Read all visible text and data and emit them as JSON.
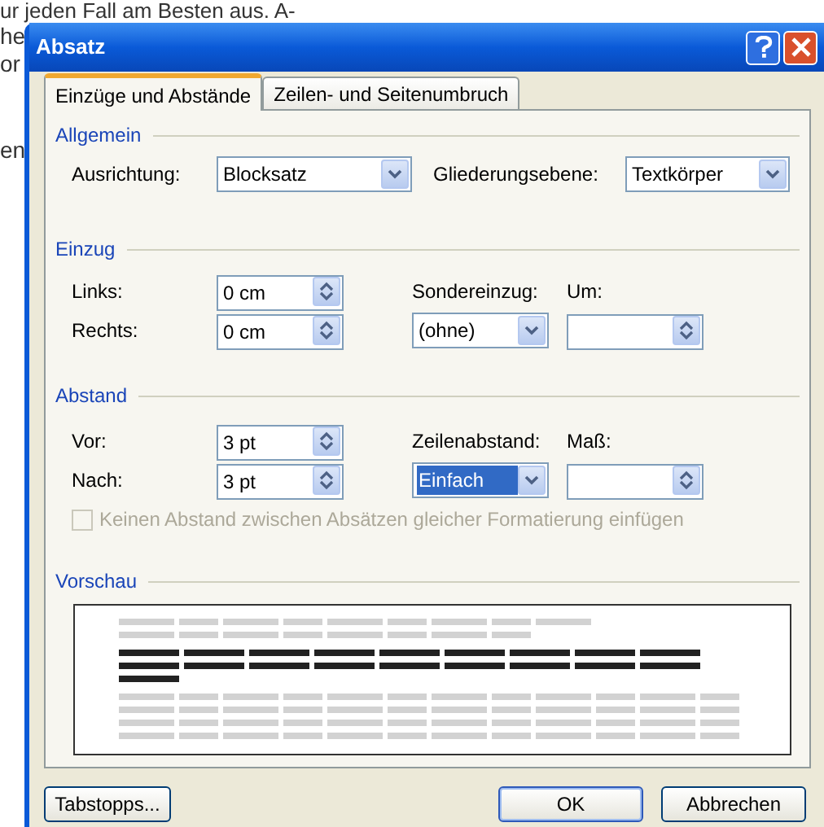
{
  "document": {
    "lines": [
      "ur jeden Fall am Besten aus. A-",
      "he",
      "or",
      "en"
    ]
  },
  "dialog": {
    "title": "Absatz",
    "tabs": [
      {
        "label": "Einzüge und Abstände",
        "selected": true
      },
      {
        "label": "Zeilen- und Seitenumbruch",
        "selected": false
      }
    ],
    "general": {
      "heading": "Allgemein",
      "alignment": {
        "label": "Ausrichtung:",
        "value": "Blocksatz"
      },
      "outline_level": {
        "label": "Gliederungsebene:",
        "value": "Textkörper"
      }
    },
    "indent": {
      "heading": "Einzug",
      "left": {
        "label": "Links:",
        "value": "0 cm"
      },
      "right": {
        "label": "Rechts:",
        "value": "0 cm"
      },
      "special": {
        "label": "Sondereinzug:",
        "value": "(ohne)"
      },
      "by": {
        "label": "Um:"
      }
    },
    "spacing": {
      "heading": "Abstand",
      "before": {
        "label": "Vor:",
        "value": "3 pt"
      },
      "after": {
        "label": "Nach:",
        "value": "3 pt"
      },
      "line_spacing": {
        "label": "Zeilenabstand:",
        "value": "Einfach",
        "selected": true
      },
      "at": {
        "label": "Maß:"
      },
      "no_space_checkbox": {
        "label": "Keinen Abstand zwischen Absätzen gleicher Formatierung einfügen",
        "checked": false,
        "disabled": true
      }
    },
    "preview": {
      "heading": "Vorschau"
    },
    "buttons": [
      {
        "label": "Tabstopps...",
        "default": false
      },
      {
        "label": "OK",
        "default": true
      },
      {
        "label": "Abbrechen",
        "default": false
      }
    ]
  }
}
